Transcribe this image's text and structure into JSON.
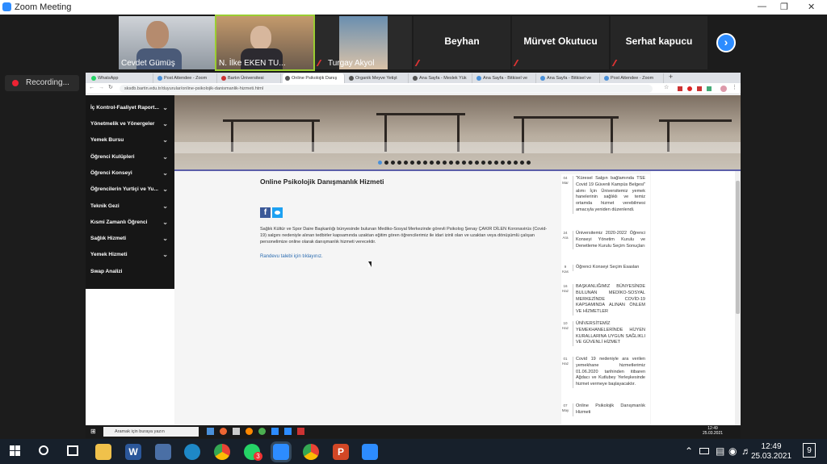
{
  "zoom": {
    "title": "Zoom Meeting",
    "recording": "Recording...",
    "participants": [
      {
        "name": "Cevdet Gümüş"
      },
      {
        "name": "N. İlke EKEN TU..."
      },
      {
        "name": "Turgay Akyol"
      },
      {
        "name": "Beyhan"
      },
      {
        "name": "Mürvet Okutucu"
      },
      {
        "name": "Serhat  kapucu"
      }
    ]
  },
  "browser": {
    "tabs": [
      "WhatsApp",
      "Post Attendee - Zoom",
      "Bartın Üniversitesi",
      "Online Psikolojik Danış",
      "Organik Meyve Yetişt",
      "Ana Sayfa - Meslek Yük",
      "Ana Sayfa - Bitkisel ve",
      "Ana Sayfa - Bitkisel ve",
      "Post Attendee - Zoom"
    ],
    "url": "sksdb.bartin.edu.tr/duyurular/online-psikolojik-danismanlik-hizmeti.html"
  },
  "sidebar": {
    "items": [
      {
        "label": "İç Kontrol-Faaliyet Raport..."
      },
      {
        "label": "Yönetmelik ve Yönergeler"
      },
      {
        "label": "Yemek Bursu"
      },
      {
        "label": "Öğrenci Kulüpleri"
      },
      {
        "label": "Öğrenci Konseyi"
      },
      {
        "label": "Öğrencilerin Yurtiçi ve Yu..."
      },
      {
        "label": "Teknik Gezi"
      },
      {
        "label": "Kısmi Zamanlı Öğrenci"
      },
      {
        "label": "Sağlık Hizmeti"
      },
      {
        "label": "Yemek Hizmeti"
      },
      {
        "label": "Swap Analizi"
      }
    ]
  },
  "article": {
    "title": "Online Psikolojik Danışmanlık Hizmeti",
    "body": "Sağlık Kültür ve Spor Daire Başkanlığı bünyesinde bulunan Mediko-Sosyal Merkezinde görevli Psikolog Şenay ÇAKIR DİLEN Koronavirüs (Covid-19) salgını nedeniyle alınan tedbirler kapsamında uzaktan eğitim gören öğrencilerimiz ile idari izinli olan ve uzaktan veya dönüşümlü çalışan personelimize online olarak danışmanlık hizmeti verecektir.",
    "link": "Randevu talebi için tıklayınız."
  },
  "news": [
    {
      "d": "04",
      "m": "Mar",
      "text": "\"Küresel Salgın bağlamında TSE Covid 19 Güvenli Kampüs Belgesi\" alımı İçin Üniversitemiz yemek hanelerinin sağlıklı ve temiz ortamda hizmet verebilmesi amacıyla yeniden düzenlendi."
    },
    {
      "d": "24",
      "m": "Ara",
      "text": "Üniversitemiz 2020-2022 Öğrenci Konseyi Yönetim Kurulu ve Denetleme Kurulu Seçim Sonuçları"
    },
    {
      "d": "9",
      "m": "Kas",
      "text": "Öğrenci Konseyi Seçim Esasları"
    },
    {
      "d": "16",
      "m": "Haz",
      "text": "BAŞKANLIĞIMIZ BÜNYESİNDE BULUNAN MEDİKO-SOSYAL MERKEZİNDE COVİD-19 KAPSAMINDA ALINAN ÖNLEM VE HİZMETLER"
    },
    {
      "d": "10",
      "m": "Haz",
      "text": "ÜNİVERSİTEMİZ YEMEKHANELERİNDE HİJYEN KURALLARINA UYGUN SAĞLIKLI VE GÜVENLİ HİZMET"
    },
    {
      "d": "01",
      "m": "Haz",
      "text": "Covid 19 nedeniyle ara verilen yemekhane hizmetlerimiz 01.06.2020 tarihinden itibaren Ağdacı ve Kutlubey Yerleşkesinde hizmet vermeye başlayacaktır."
    },
    {
      "d": "07",
      "m": "May",
      "text": "Online Psikolojik Danışmanlık Hizmeti"
    }
  ],
  "inner_taskbar": {
    "search": "Aramak için buraya yazın",
    "time": "12:49",
    "date": "25.03.2021"
  },
  "taskbar": {
    "time": "12:49",
    "date": "25.03.2021",
    "whatsapp_badge": "3",
    "notif_count": "9"
  },
  "colors": {
    "zoom_blue": "#2d8cff",
    "page_accent": "#5b5ea8",
    "link": "#2b6cb0"
  }
}
